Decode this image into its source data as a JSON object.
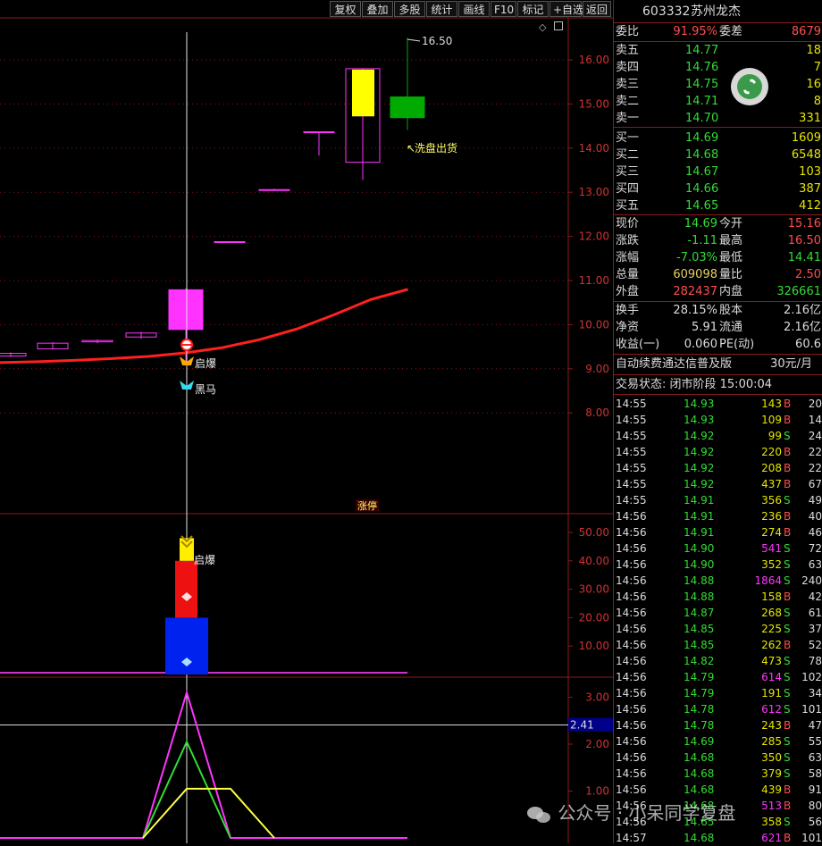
{
  "toolbar": {
    "buttons": [
      "复权",
      "叠加",
      "多股",
      "统计",
      "画线",
      "F10",
      "标记",
      "+自选",
      "返回"
    ]
  },
  "chart": {
    "price_ticks": [
      "16.00",
      "15.00",
      "14.00",
      "13.00",
      "12.00",
      "11.00",
      "10.00",
      "9.00",
      "8.00"
    ],
    "high_label": "16.50",
    "ann_wash": "洗盘出货",
    "ann_qibao": "启爆",
    "ann_heima": "黑马",
    "ann_zhangting": "涨停",
    "vol_ticks": [
      "50.00",
      "40.00",
      "30.00",
      "20.00",
      "10.00"
    ],
    "vol_qibao": "启爆",
    "ind_ticks": [
      "3.00",
      "2.00",
      "1.00"
    ],
    "ind_current": "2.41",
    "watermark": "公众号 · 小呆同学复盘",
    "colors": {
      "up": "#ff33ff",
      "down": "#00aa00",
      "ma": "#ff2020",
      "grid": "#8b1a1a"
    }
  },
  "chart_data": {
    "type": "candlestick",
    "candles": [
      {
        "open": 9.29,
        "close": 9.35,
        "high": 9.37,
        "low": 9.27
      },
      {
        "open": 9.45,
        "close": 9.58,
        "high": 9.6,
        "low": 9.44
      },
      {
        "open": 9.61,
        "close": 9.64,
        "high": 9.66,
        "low": 9.58
      },
      {
        "open": 9.72,
        "close": 9.81,
        "high": 9.84,
        "low": 9.68
      },
      {
        "open": 9.89,
        "close": 10.79,
        "high": 10.82,
        "low": 9.16
      },
      {
        "open": 11.88,
        "close": 11.88,
        "high": 11.88,
        "low": 11.87
      },
      {
        "open": 13.06,
        "close": 13.06,
        "high": 13.08,
        "low": 13.05
      },
      {
        "open": 14.37,
        "close": 14.37,
        "high": 14.38,
        "low": 13.83
      },
      {
        "open": 13.68,
        "close": 15.8,
        "high": 15.8,
        "low": 13.28
      },
      {
        "open": 15.16,
        "close": 14.69,
        "high": 16.5,
        "low": 14.41
      }
    ],
    "ma": [
      9.14,
      9.16,
      9.19,
      9.23,
      9.28,
      9.36,
      9.48,
      9.66,
      9.9,
      10.22,
      10.57,
      10.8
    ],
    "volume": [
      {
        "value": 20,
        "color": "blue"
      },
      {
        "value": 40,
        "color": "red"
      },
      {
        "value": 48,
        "color": "yellow"
      }
    ],
    "indicator": {
      "magenta_peak": 3.1,
      "green_peak": 2.05,
      "yellow_level": 1.05,
      "current": 2.41
    }
  },
  "side": {
    "code": "603332",
    "name": "苏州龙杰",
    "weibi": {
      "label": "委比",
      "value": "91.95%",
      "label2": "委差",
      "value2": "8679"
    },
    "sells": [
      {
        "label": "卖五",
        "price": "14.77",
        "vol": "18"
      },
      {
        "label": "卖四",
        "price": "14.76",
        "vol": "7"
      },
      {
        "label": "卖三",
        "price": "14.75",
        "vol": "16"
      },
      {
        "label": "卖二",
        "price": "14.71",
        "vol": "8"
      },
      {
        "label": "卖一",
        "price": "14.70",
        "vol": "331"
      }
    ],
    "buys": [
      {
        "label": "买一",
        "price": "14.69",
        "vol": "1609"
      },
      {
        "label": "买二",
        "price": "14.68",
        "vol": "6548"
      },
      {
        "label": "买三",
        "price": "14.67",
        "vol": "103"
      },
      {
        "label": "买四",
        "price": "14.66",
        "vol": "387"
      },
      {
        "label": "买五",
        "price": "14.65",
        "vol": "412"
      }
    ],
    "quote": [
      {
        "l1": "现价",
        "v1": "14.69",
        "l2": "今开",
        "v2": "15.16"
      },
      {
        "l1": "涨跌",
        "v1": "-1.11",
        "l2": "最高",
        "v2": "16.50"
      },
      {
        "l1": "涨幅",
        "v1": "-7.03%",
        "l2": "最低",
        "v2": "14.41"
      },
      {
        "l1": "总量",
        "v1": "609098",
        "l2": "量比",
        "v2": "2.50"
      },
      {
        "l1": "外盘",
        "v1": "282437",
        "l2": "内盘",
        "v2": "326661"
      }
    ],
    "fund": [
      {
        "l1": "换手",
        "v1": "28.15%",
        "l2": "股本",
        "v2": "2.16亿"
      },
      {
        "l1": "净资",
        "v1": "5.91",
        "l2": "流通",
        "v2": "2.16亿"
      },
      {
        "l1": "收益(一)",
        "v1": "0.060",
        "l2": "PE(动)",
        "v2": "60.6"
      }
    ],
    "promo": "自动续费通达信普及版",
    "promo_price": "30元/月",
    "status": "交易状态: 闭市阶段 15:00:04",
    "ticks": [
      [
        "14:55",
        "14.93",
        "143",
        "B",
        "20"
      ],
      [
        "14:55",
        "14.93",
        "109",
        "B",
        "14"
      ],
      [
        "14:55",
        "14.92",
        "99",
        "S",
        "24"
      ],
      [
        "14:55",
        "14.92",
        "220",
        "B",
        "22"
      ],
      [
        "14:55",
        "14.92",
        "208",
        "B",
        "22"
      ],
      [
        "14:55",
        "14.92",
        "437",
        "B",
        "67"
      ],
      [
        "14:55",
        "14.91",
        "356",
        "S",
        "49"
      ],
      [
        "14:56",
        "14.91",
        "236",
        "B",
        "40"
      ],
      [
        "14:56",
        "14.91",
        "274",
        "B",
        "46"
      ],
      [
        "14:56",
        "14.90",
        "541",
        "S",
        "72"
      ],
      [
        "14:56",
        "14.90",
        "352",
        "S",
        "63"
      ],
      [
        "14:56",
        "14.88",
        "1864",
        "S",
        "240"
      ],
      [
        "14:56",
        "14.88",
        "158",
        "B",
        "42"
      ],
      [
        "14:56",
        "14.87",
        "268",
        "S",
        "61"
      ],
      [
        "14:56",
        "14.85",
        "225",
        "S",
        "37"
      ],
      [
        "14:56",
        "14.85",
        "262",
        "B",
        "52"
      ],
      [
        "14:56",
        "14.82",
        "473",
        "S",
        "78"
      ],
      [
        "14:56",
        "14.79",
        "614",
        "S",
        "102"
      ],
      [
        "14:56",
        "14.79",
        "191",
        "S",
        "34"
      ],
      [
        "14:56",
        "14.78",
        "612",
        "S",
        "101"
      ],
      [
        "14:56",
        "14.78",
        "243",
        "B",
        "47"
      ],
      [
        "14:56",
        "14.69",
        "285",
        "S",
        "55"
      ],
      [
        "14:56",
        "14.68",
        "350",
        "S",
        "63"
      ],
      [
        "14:56",
        "14.68",
        "379",
        "S",
        "58"
      ],
      [
        "14:56",
        "14.68",
        "439",
        "B",
        "91"
      ],
      [
        "14:56",
        "14.68",
        "513",
        "B",
        "80"
      ],
      [
        "14:56",
        "14.65",
        "358",
        "S",
        "56"
      ],
      [
        "14:57",
        "14.68",
        "621",
        "B",
        "101"
      ]
    ]
  }
}
